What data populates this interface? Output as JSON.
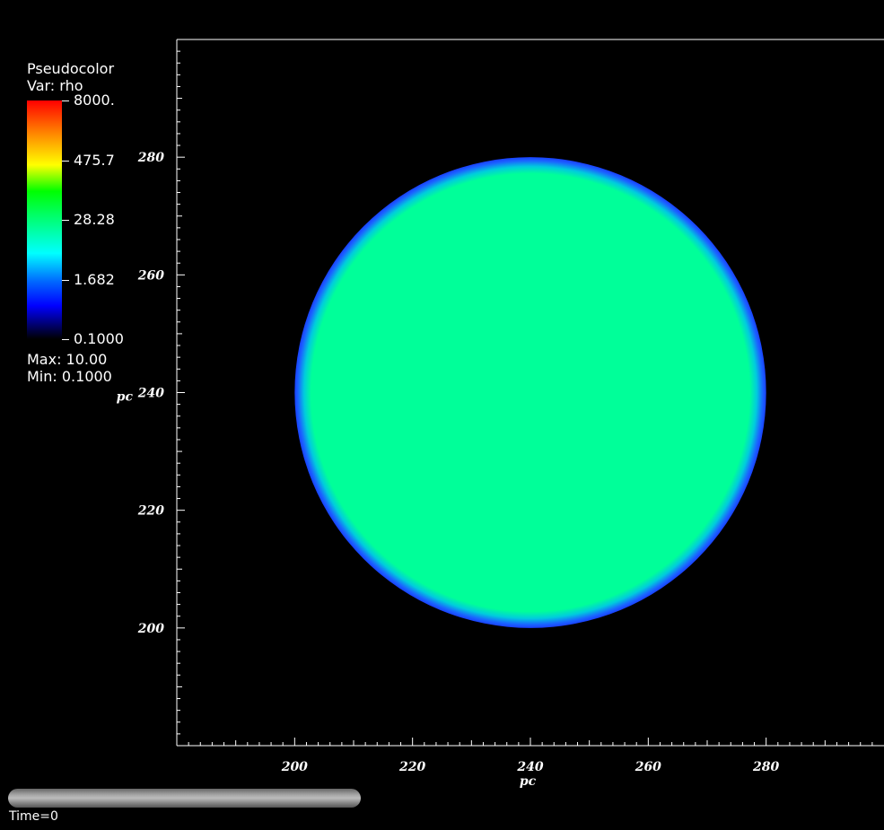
{
  "legend": {
    "plot_type": "Pseudocolor",
    "var_label": "Var: rho",
    "tick_labels": [
      "8000.",
      "475.7",
      "28.28",
      "1.682",
      "0.1000"
    ],
    "max_label": "Max:  10.00",
    "min_label": "Min:  0.1000"
  },
  "time_label": "Time=0",
  "colors": {
    "background": "#000000",
    "disk_fill": "#00ff99",
    "disk_rim": "#1a5cff",
    "axis": "#ffffff"
  },
  "chart_data": {
    "type": "heatmap",
    "xlabel": "pc",
    "ylabel": "pc",
    "xlim": [
      180,
      300
    ],
    "ylim": [
      180,
      300
    ],
    "x_ticks": [
      200,
      220,
      240,
      260,
      280
    ],
    "y_ticks": [
      200,
      220,
      240,
      260,
      280
    ],
    "variable": "rho",
    "colorbar_range": [
      0.1,
      8000
    ],
    "colorbar_scale": "log",
    "data_max": 10.0,
    "data_min": 0.1,
    "sphere": {
      "center": [
        240,
        240
      ],
      "radius": 40,
      "interior_value": 10.0,
      "background_value": 0.1
    }
  }
}
